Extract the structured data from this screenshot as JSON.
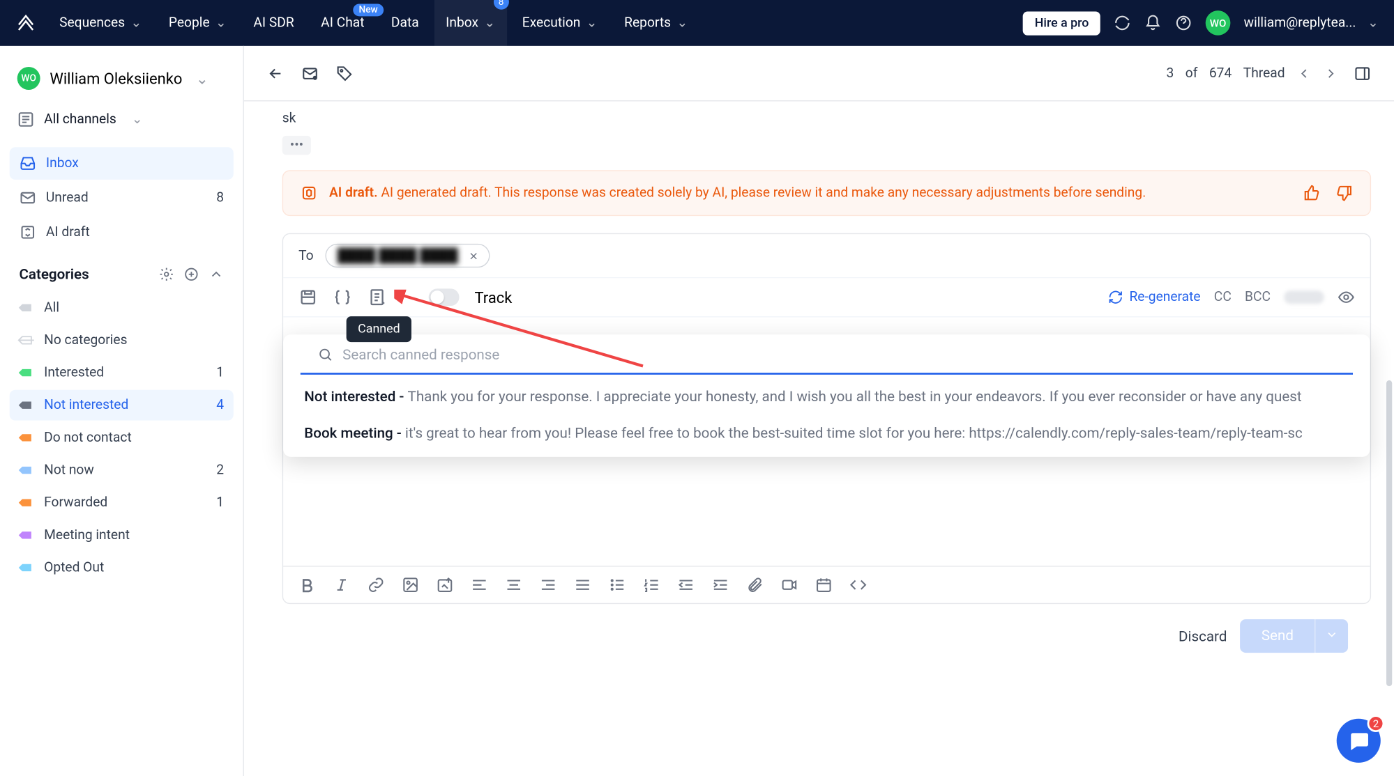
{
  "nav": {
    "items": [
      "Sequences",
      "People",
      "AI SDR",
      "AI Chat",
      "Data",
      "Inbox",
      "Execution",
      "Reports"
    ],
    "new_badge": "New",
    "inbox_badge": "8",
    "hire": "Hire a pro",
    "email": "william@replytea..."
  },
  "user": {
    "initials": "WO",
    "name": "William Oleksiienko"
  },
  "sidebar": {
    "channel": "All channels",
    "inbox": "Inbox",
    "unread": "Unread",
    "unread_count": "8",
    "aidraft": "AI draft",
    "categories_title": "Categories",
    "cats": [
      {
        "label": "All"
      },
      {
        "label": "No categories"
      },
      {
        "label": "Interested",
        "count": "1",
        "color": "#4ade80"
      },
      {
        "label": "Not interested",
        "count": "4",
        "color": "#6b7280",
        "active": true
      },
      {
        "label": "Do not contact",
        "color": "#fb923c"
      },
      {
        "label": "Not now",
        "count": "2",
        "color": "#93c5fd"
      },
      {
        "label": "Forwarded",
        "count": "1",
        "color": "#fb923c"
      },
      {
        "label": "Meeting intent",
        "color": "#c084fc"
      },
      {
        "label": "Opted Out",
        "color": "#7dd3fc"
      }
    ]
  },
  "toolbar": {
    "counter_pre": "3",
    "counter_of": "of",
    "counter_total": "674",
    "thread": "Thread"
  },
  "message": {
    "head": "sk"
  },
  "ai_banner": {
    "strong": "AI draft.",
    "text": " AI generated draft. This response was created solely by AI, please review it and make any necessary adjustments before sending."
  },
  "composer": {
    "to_label": "To",
    "recipient": "████ ████ ████",
    "track": "Track",
    "regenerate": "Re-generate",
    "cc": "CC",
    "bcc": "BCC",
    "tooltip": "Canned"
  },
  "canned": {
    "placeholder": "Search canned response",
    "items": [
      {
        "label": "Not interested - ",
        "text": "Thank you for your response. I appreciate your honesty, and I wish you all the best in your endeavors.    If you ever reconsider or have any quest"
      },
      {
        "label": "Book meeting - ",
        "text": "it's great to hear from you!    Please feel free to book the best-suited time slot for you here: https://calendly.com/reply-sales-team/reply-team-sc"
      }
    ]
  },
  "footer": {
    "discard": "Discard",
    "send": "Send"
  },
  "chat_badge": "2"
}
